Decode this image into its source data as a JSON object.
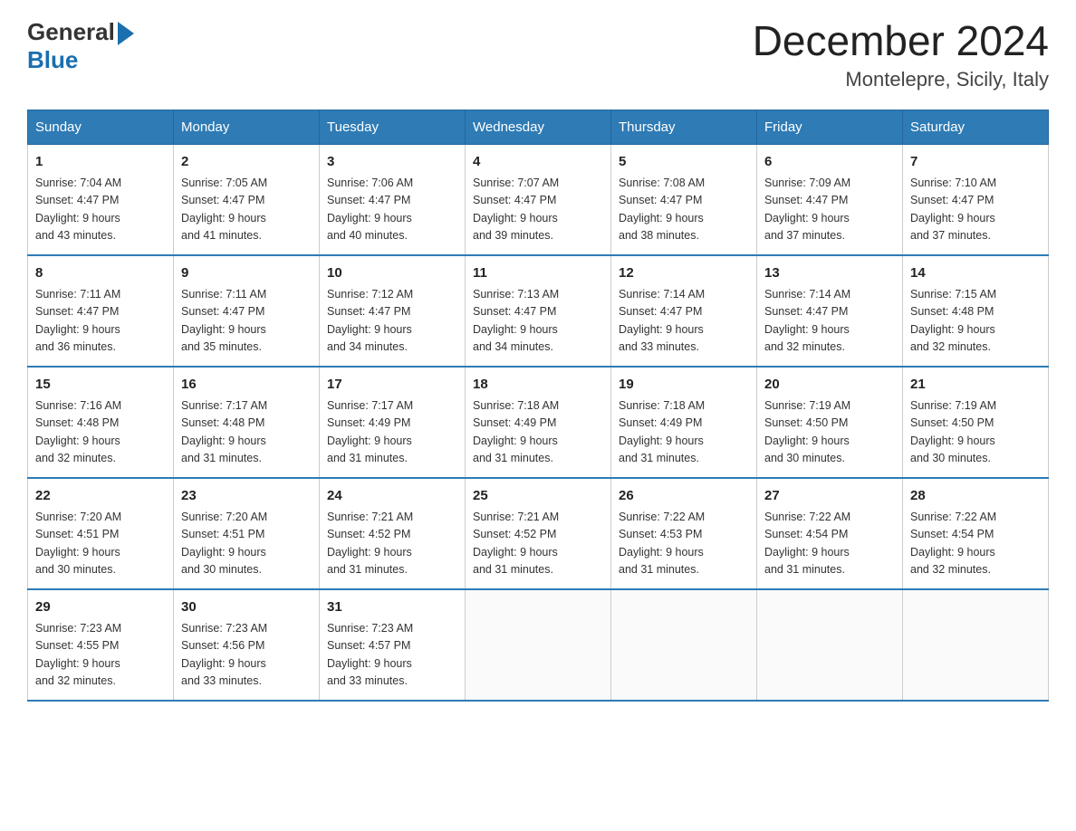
{
  "header": {
    "logo_general": "General",
    "logo_blue": "Blue",
    "title": "December 2024",
    "subtitle": "Montelepre, Sicily, Italy"
  },
  "days_of_week": [
    "Sunday",
    "Monday",
    "Tuesday",
    "Wednesday",
    "Thursday",
    "Friday",
    "Saturday"
  ],
  "weeks": [
    [
      {
        "num": "1",
        "sunrise": "7:04 AM",
        "sunset": "4:47 PM",
        "daylight": "9 hours and 43 minutes."
      },
      {
        "num": "2",
        "sunrise": "7:05 AM",
        "sunset": "4:47 PM",
        "daylight": "9 hours and 41 minutes."
      },
      {
        "num": "3",
        "sunrise": "7:06 AM",
        "sunset": "4:47 PM",
        "daylight": "9 hours and 40 minutes."
      },
      {
        "num": "4",
        "sunrise": "7:07 AM",
        "sunset": "4:47 PM",
        "daylight": "9 hours and 39 minutes."
      },
      {
        "num": "5",
        "sunrise": "7:08 AM",
        "sunset": "4:47 PM",
        "daylight": "9 hours and 38 minutes."
      },
      {
        "num": "6",
        "sunrise": "7:09 AM",
        "sunset": "4:47 PM",
        "daylight": "9 hours and 37 minutes."
      },
      {
        "num": "7",
        "sunrise": "7:10 AM",
        "sunset": "4:47 PM",
        "daylight": "9 hours and 37 minutes."
      }
    ],
    [
      {
        "num": "8",
        "sunrise": "7:11 AM",
        "sunset": "4:47 PM",
        "daylight": "9 hours and 36 minutes."
      },
      {
        "num": "9",
        "sunrise": "7:11 AM",
        "sunset": "4:47 PM",
        "daylight": "9 hours and 35 minutes."
      },
      {
        "num": "10",
        "sunrise": "7:12 AM",
        "sunset": "4:47 PM",
        "daylight": "9 hours and 34 minutes."
      },
      {
        "num": "11",
        "sunrise": "7:13 AM",
        "sunset": "4:47 PM",
        "daylight": "9 hours and 34 minutes."
      },
      {
        "num": "12",
        "sunrise": "7:14 AM",
        "sunset": "4:47 PM",
        "daylight": "9 hours and 33 minutes."
      },
      {
        "num": "13",
        "sunrise": "7:14 AM",
        "sunset": "4:47 PM",
        "daylight": "9 hours and 32 minutes."
      },
      {
        "num": "14",
        "sunrise": "7:15 AM",
        "sunset": "4:48 PM",
        "daylight": "9 hours and 32 minutes."
      }
    ],
    [
      {
        "num": "15",
        "sunrise": "7:16 AM",
        "sunset": "4:48 PM",
        "daylight": "9 hours and 32 minutes."
      },
      {
        "num": "16",
        "sunrise": "7:17 AM",
        "sunset": "4:48 PM",
        "daylight": "9 hours and 31 minutes."
      },
      {
        "num": "17",
        "sunrise": "7:17 AM",
        "sunset": "4:49 PM",
        "daylight": "9 hours and 31 minutes."
      },
      {
        "num": "18",
        "sunrise": "7:18 AM",
        "sunset": "4:49 PM",
        "daylight": "9 hours and 31 minutes."
      },
      {
        "num": "19",
        "sunrise": "7:18 AM",
        "sunset": "4:49 PM",
        "daylight": "9 hours and 31 minutes."
      },
      {
        "num": "20",
        "sunrise": "7:19 AM",
        "sunset": "4:50 PM",
        "daylight": "9 hours and 30 minutes."
      },
      {
        "num": "21",
        "sunrise": "7:19 AM",
        "sunset": "4:50 PM",
        "daylight": "9 hours and 30 minutes."
      }
    ],
    [
      {
        "num": "22",
        "sunrise": "7:20 AM",
        "sunset": "4:51 PM",
        "daylight": "9 hours and 30 minutes."
      },
      {
        "num": "23",
        "sunrise": "7:20 AM",
        "sunset": "4:51 PM",
        "daylight": "9 hours and 30 minutes."
      },
      {
        "num": "24",
        "sunrise": "7:21 AM",
        "sunset": "4:52 PM",
        "daylight": "9 hours and 31 minutes."
      },
      {
        "num": "25",
        "sunrise": "7:21 AM",
        "sunset": "4:52 PM",
        "daylight": "9 hours and 31 minutes."
      },
      {
        "num": "26",
        "sunrise": "7:22 AM",
        "sunset": "4:53 PM",
        "daylight": "9 hours and 31 minutes."
      },
      {
        "num": "27",
        "sunrise": "7:22 AM",
        "sunset": "4:54 PM",
        "daylight": "9 hours and 31 minutes."
      },
      {
        "num": "28",
        "sunrise": "7:22 AM",
        "sunset": "4:54 PM",
        "daylight": "9 hours and 32 minutes."
      }
    ],
    [
      {
        "num": "29",
        "sunrise": "7:23 AM",
        "sunset": "4:55 PM",
        "daylight": "9 hours and 32 minutes."
      },
      {
        "num": "30",
        "sunrise": "7:23 AM",
        "sunset": "4:56 PM",
        "daylight": "9 hours and 33 minutes."
      },
      {
        "num": "31",
        "sunrise": "7:23 AM",
        "sunset": "4:57 PM",
        "daylight": "9 hours and 33 minutes."
      },
      null,
      null,
      null,
      null
    ]
  ],
  "labels": {
    "sunrise": "Sunrise:",
    "sunset": "Sunset:",
    "daylight": "Daylight:"
  }
}
